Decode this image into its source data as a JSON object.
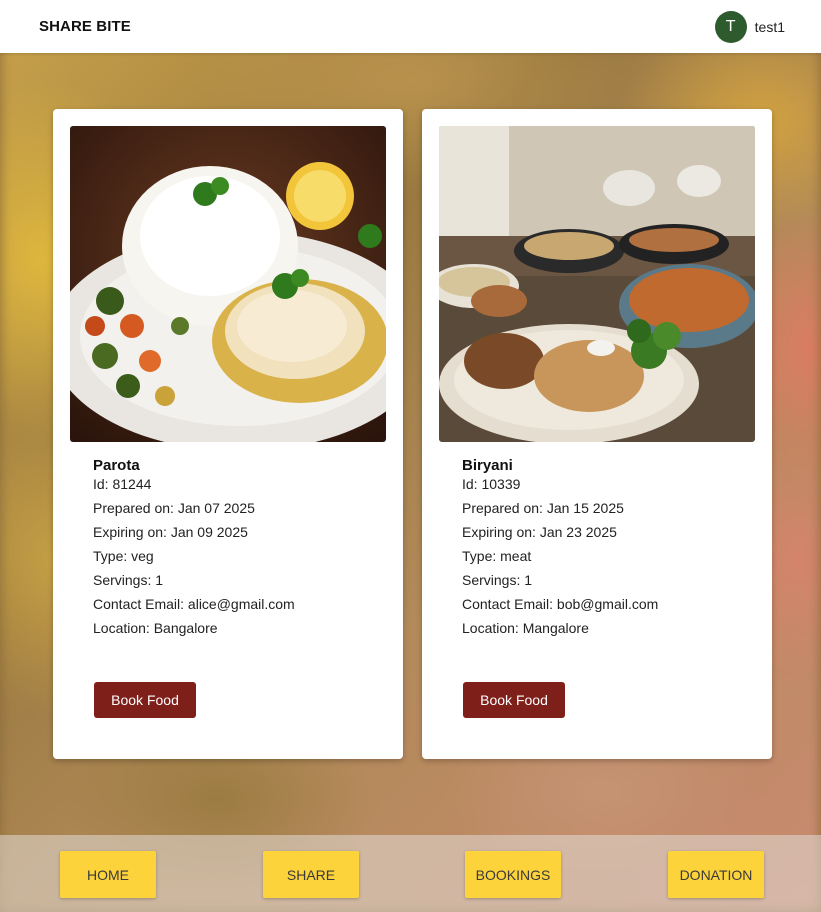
{
  "app": {
    "brand": "SHARE BITE",
    "user": {
      "initial": "T",
      "name": "test1"
    }
  },
  "colors": {
    "book_button": "#7f1f1a",
    "nav_button": "#fdd33b",
    "avatar": "#2e5b2e"
  },
  "cards": [
    {
      "name": "Parota",
      "id": "Id: 81244",
      "prepared": "Prepared on: Jan 07 2025",
      "expiring": "Expiring on: Jan 09 2025",
      "type": "Type: veg",
      "servings": "Servings: 1",
      "email": "Contact Email: alice@gmail.com",
      "location": "Location: Bangalore",
      "button": "Book Food"
    },
    {
      "name": "Biryani",
      "id": "Id: 10339",
      "prepared": "Prepared on: Jan 15 2025",
      "expiring": "Expiring on: Jan 23 2025",
      "type": "Type: meat",
      "servings": "Servings: 1",
      "email": "Contact Email: bob@gmail.com",
      "location": "Location: Mangalore",
      "button": "Book Food"
    }
  ],
  "nav": {
    "home": "Home",
    "share": "Share",
    "bookings": "Bookings",
    "donation": "Donation"
  }
}
